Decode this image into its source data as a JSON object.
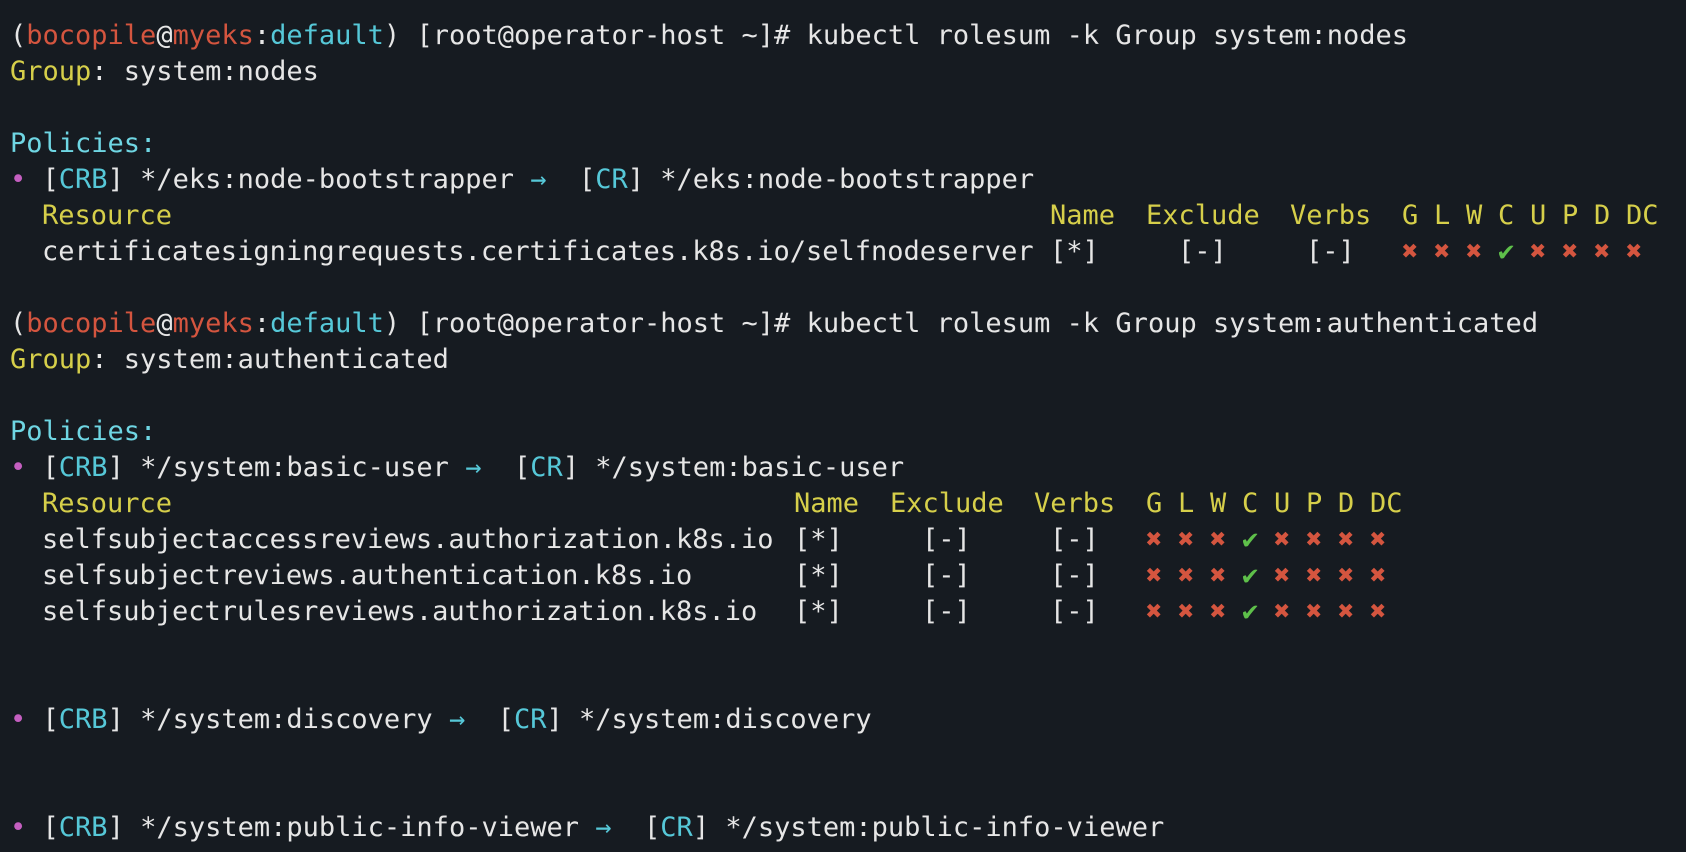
{
  "prompt": {
    "open": "(",
    "user": "bocopile",
    "at": "@",
    "host": "myeks",
    "colon": ":",
    "ns": "default",
    "close": ")",
    "shell": " [root@operator-host ~]# "
  },
  "block1": {
    "command": "kubectl rolesum -k Group system:nodes",
    "group_label": "Group",
    "group_value": ": system:nodes",
    "policies_label": "Policies:",
    "binding": {
      "bullet": "•",
      "crb_open": "[",
      "crb": "CRB",
      "crb_close": "] */eks:node-bootstrapper ",
      "arrow": "→",
      "cr_open": "  [",
      "cr": "CR",
      "cr_close": "] */eks:node-bootstrapper"
    },
    "header": {
      "resource": "Resource",
      "name": "Name",
      "exclude": "Exclude",
      "verbs": "Verbs",
      "g": "G",
      "l": "L",
      "w": "W",
      "c": "C",
      "u": "U",
      "p": "P",
      "d": "D",
      "dc": "DC"
    },
    "rows": [
      {
        "resource": "certificatesigningrequests.certificates.k8s.io/selfnodeserver",
        "name": "[*]",
        "exclude": "[-]",
        "verbs": "[-]",
        "perms": [
          "✖",
          "✖",
          "✖",
          "✔",
          "✖",
          "✖",
          "✖",
          "✖"
        ]
      }
    ]
  },
  "block2": {
    "command": "kubectl rolesum -k Group system:authenticated",
    "group_label": "Group",
    "group_value": ": system:authenticated",
    "policies_label": "Policies:",
    "binding": {
      "bullet": "•",
      "crb_open": "[",
      "crb": "CRB",
      "crb_close": "] */system:basic-user ",
      "arrow": "→",
      "cr_open": "  [",
      "cr": "CR",
      "cr_close": "] */system:basic-user"
    },
    "header": {
      "resource": "Resource",
      "name": "Name",
      "exclude": "Exclude",
      "verbs": "Verbs",
      "g": "G",
      "l": "L",
      "w": "W",
      "c": "C",
      "u": "U",
      "p": "P",
      "d": "D",
      "dc": "DC"
    },
    "rows": [
      {
        "resource": "selfsubjectaccessreviews.authorization.k8s.io",
        "name": "[*]",
        "exclude": "[-]",
        "verbs": "[-]",
        "perms": [
          "✖",
          "✖",
          "✖",
          "✔",
          "✖",
          "✖",
          "✖",
          "✖"
        ]
      },
      {
        "resource": "selfsubjectreviews.authentication.k8s.io",
        "name": "[*]",
        "exclude": "[-]",
        "verbs": "[-]",
        "perms": [
          "✖",
          "✖",
          "✖",
          "✔",
          "✖",
          "✖",
          "✖",
          "✖"
        ]
      },
      {
        "resource": "selfsubjectrulesreviews.authorization.k8s.io",
        "name": "[*]",
        "exclude": "[-]",
        "verbs": "[-]",
        "perms": [
          "✖",
          "✖",
          "✖",
          "✔",
          "✖",
          "✖",
          "✖",
          "✖"
        ]
      }
    ],
    "binding2": {
      "bullet": "•",
      "crb_open": "[",
      "crb": "CRB",
      "crb_close": "] */system:discovery ",
      "arrow": "→",
      "cr_open": "  [",
      "cr": "CR",
      "cr_close": "] */system:discovery"
    },
    "binding3": {
      "bullet": "•",
      "crb_open": "[",
      "crb": "CRB",
      "crb_close": "] */system:public-info-viewer ",
      "arrow": "→",
      "cr_open": "  [",
      "cr": "CR",
      "cr_close": "] */system:public-info-viewer"
    }
  }
}
